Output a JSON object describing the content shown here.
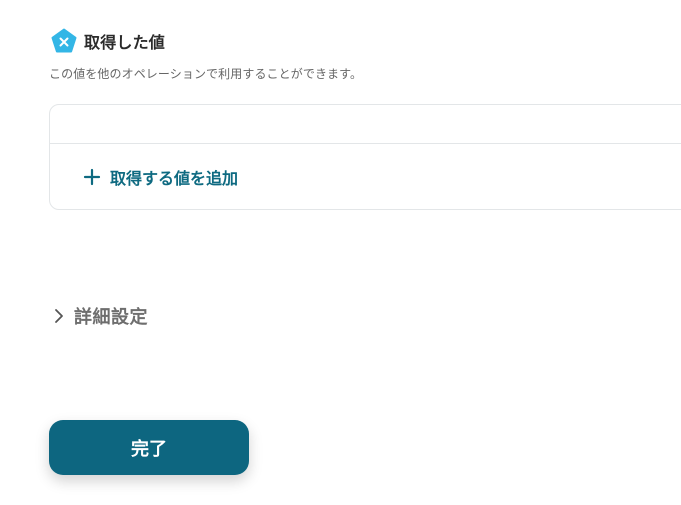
{
  "output_section": {
    "title": "取得した値",
    "description": "この値を他のオペレーションで利用することができます。",
    "icon": "output-badge-icon",
    "icon_color": "#33b6e6"
  },
  "values_box": {
    "add_label": "取得する値を追加",
    "add_icon": "plus-icon",
    "accent_color": "#0e6a81"
  },
  "advanced_settings": {
    "label": "詳細設定",
    "icon": "chevron-right-icon"
  },
  "footer": {
    "done_label": "完了",
    "button_color": "#0d6680"
  }
}
